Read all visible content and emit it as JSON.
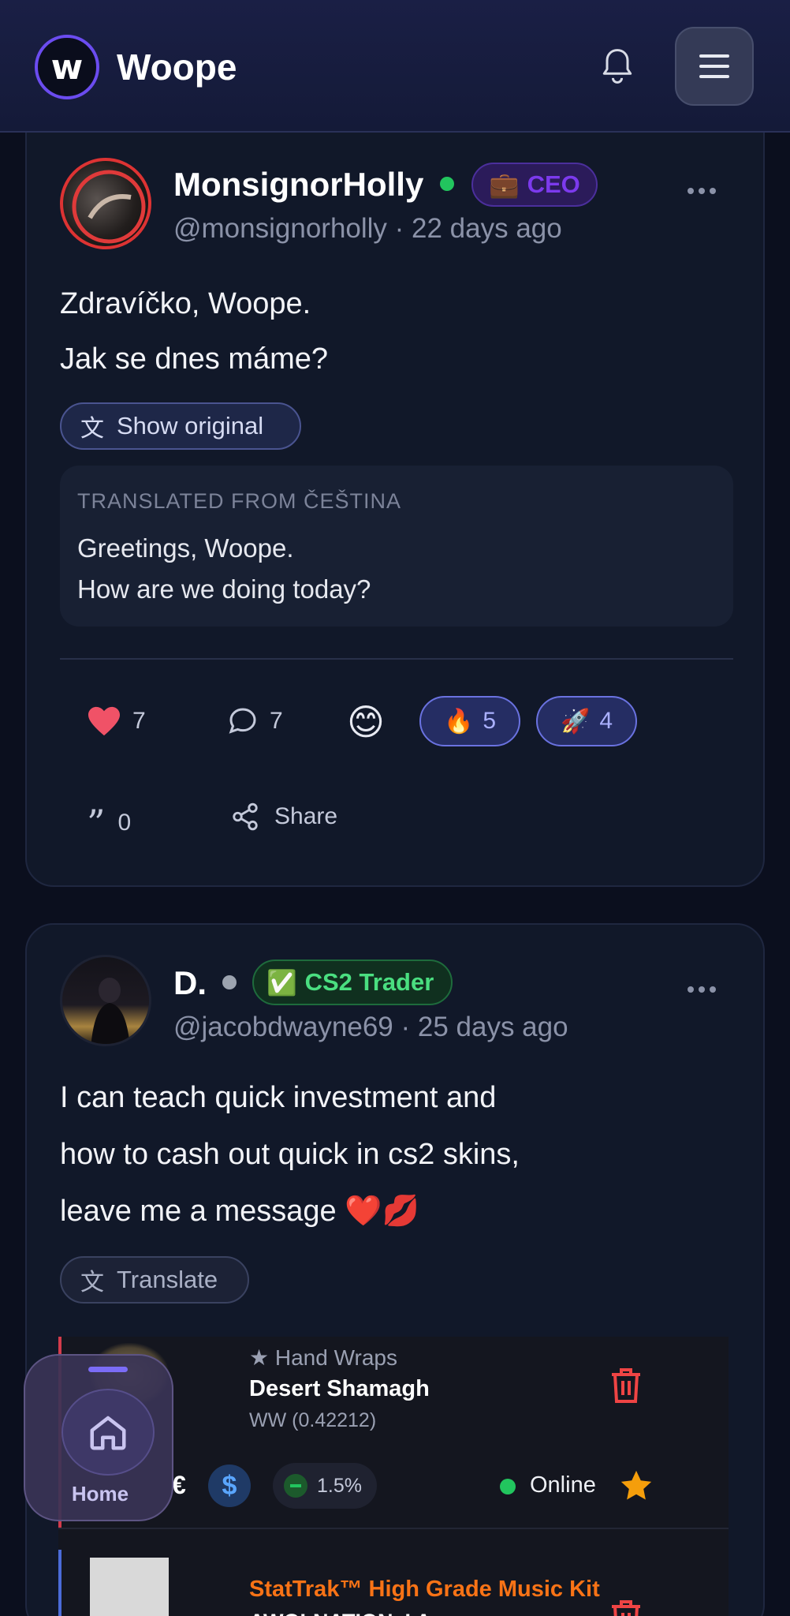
{
  "app": {
    "name": "Woope",
    "logo_letter": "w"
  },
  "header": {
    "notifications_icon": "bell-icon",
    "menu_icon": "hamburger-icon"
  },
  "posts": [
    {
      "username": "MonsignorHolly",
      "status": "online",
      "status_color": "#22c55e",
      "badge": {
        "emoji": "💼",
        "label": "CEO",
        "color": "#7c3aed"
      },
      "handle_time": "@monsignorholly · 22 days ago",
      "lines": [
        "Zdravíčko, Woope.",
        "Jak se dnes máme?"
      ],
      "translate_button": "Show original",
      "translation": {
        "header": "TRANSLATED FROM ČEŠTINA",
        "lines": [
          "Greetings, Woope.",
          "How are we doing today?"
        ]
      },
      "likes": "7",
      "comments": "7",
      "add_reaction_emoji": "😊",
      "reactions": [
        {
          "emoji": "🔥",
          "count": "5"
        },
        {
          "emoji": "🚀",
          "count": "4"
        }
      ],
      "quotes": "0",
      "share_label": "Share"
    },
    {
      "username": "D.",
      "status": "offline",
      "status_color": "#9ca3af",
      "badge": {
        "emoji": "✅",
        "label": "CS2 Trader",
        "color": "#4ade80"
      },
      "handle_time": "@jacobdwayne69 · 25 days ago",
      "lines": [
        "I can teach quick investment and",
        "how to cash out quick in cs2 skins,",
        "leave me a message ❤️💋"
      ],
      "translate_button": "Translate",
      "trade_items": [
        {
          "category": "★ Hand Wraps",
          "name": "Desert Shamagh",
          "wear": "WW (0.42212)",
          "currency_symbol": "€",
          "discount": "1.5%",
          "status": "Online"
        },
        {
          "name": "StatTrak™ High Grade Music Kit",
          "subname": "AWOLNATION, I A..."
        }
      ]
    }
  ],
  "bottom_nav": {
    "home_label": "Home"
  }
}
